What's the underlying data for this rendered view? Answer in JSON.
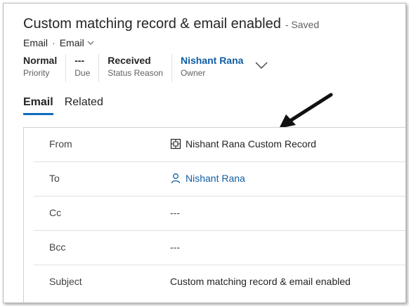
{
  "header": {
    "title": "Custom matching record & email enabled",
    "saved": "- Saved",
    "entity": "Email",
    "form": "Email",
    "separator": "·"
  },
  "header_fields": [
    {
      "value": "Normal",
      "label": "Priority"
    },
    {
      "value": "---",
      "label": "Due"
    },
    {
      "value": "Received",
      "label": "Status Reason"
    },
    {
      "value": "Nishant Rana",
      "label": "Owner"
    }
  ],
  "tabs": [
    {
      "label": "Email",
      "active": true
    },
    {
      "label": "Related",
      "active": false
    }
  ],
  "fields": {
    "from": {
      "label": "From",
      "value": "Nishant Rana Custom Record",
      "icon": "custom-entity-icon"
    },
    "to": {
      "label": "To",
      "value": "Nishant Rana",
      "icon": "person-icon"
    },
    "cc": {
      "label": "Cc",
      "value": "---"
    },
    "bcc": {
      "label": "Bcc",
      "value": "---"
    },
    "subject": {
      "label": "Subject",
      "value": "Custom matching record & email enabled"
    }
  },
  "colors": {
    "accent": "#0f6cbd",
    "link": "#115ea3"
  },
  "annotation": {
    "icon": "arrow-pointer-icon"
  }
}
